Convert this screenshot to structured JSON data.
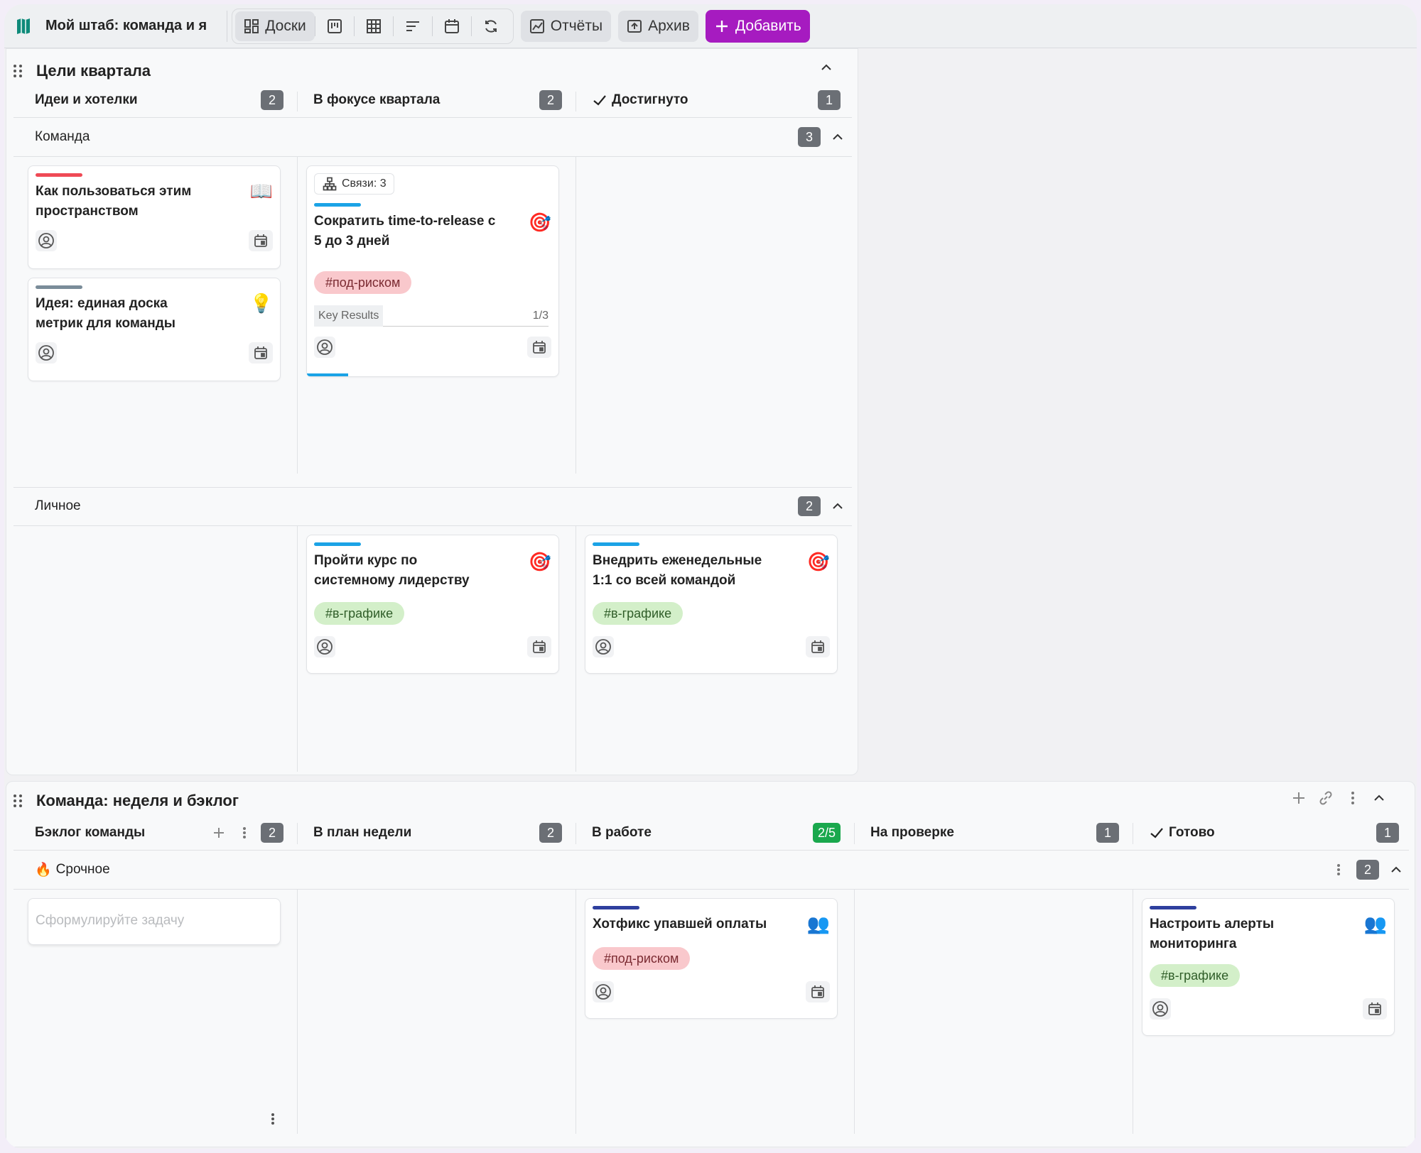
{
  "toolbar": {
    "workspace_title": "Мой штаб: команда и я",
    "boards_label": "Доски",
    "reports_label": "Отчёты",
    "archive_label": "Архив",
    "add_label": "Добавить",
    "accent_color": "#a61bc0"
  },
  "board1": {
    "title": "Цели квартала",
    "columns": [
      {
        "name": "Идеи и хотелки",
        "count": "2"
      },
      {
        "name": "В фокусе квартала",
        "count": "2"
      },
      {
        "name": "Достигнуто",
        "count": "1"
      }
    ],
    "swimlanes": [
      {
        "name": "Команда",
        "count": "3"
      },
      {
        "name": "Личное",
        "count": "2"
      }
    ],
    "cards": {
      "how_to_use": {
        "title_line1": "Как пользоваться этим",
        "title_line2": "пространством",
        "emoji": "📖",
        "stripe_color": "#ef4a55"
      },
      "idea_metrics": {
        "title_line1": "Идея: единая доска",
        "title_line2": "метрик для команды",
        "emoji": "💡",
        "stripe_color": "#7a8c99"
      },
      "time_to_release": {
        "links": "Связи: 3",
        "title_line1": "Сократить time-to-release с",
        "title_line2": "5 до 3 дней",
        "emoji": "🎯",
        "tag": "#под-риском",
        "kr_label": "Key Results",
        "kr_count": "1/3",
        "stripe_color": "#1ba3e6"
      },
      "leadership_course": {
        "title_line1": "Пройти курс по",
        "title_line2": "системному лидерству",
        "emoji": "🎯",
        "tag": "#в-графике",
        "stripe_color": "#1ba3e6"
      },
      "weekly_1on1": {
        "title_line1": "Внедрить еженедельные",
        "title_line2": "1:1 со всей командой",
        "emoji": "🎯",
        "tag": "#в-графике",
        "stripe_color": "#1ba3e6"
      }
    }
  },
  "board2": {
    "title": "Команда: неделя и бэклог",
    "columns": [
      {
        "name": "Бэклог команды",
        "count": "2"
      },
      {
        "name": "В план недели",
        "count": "2"
      },
      {
        "name": "В работе",
        "count": "2/5"
      },
      {
        "name": "На проверке",
        "count": "1"
      },
      {
        "name": "Готово",
        "count": "1"
      }
    ],
    "swimlane": {
      "name": "Срочное",
      "emoji": "🔥",
      "count": "2"
    },
    "new_task_placeholder": "Сформулируйте задачу",
    "cards": {
      "hotfix": {
        "title_line1": "Хотфикс упавшей оплаты",
        "emoji": "👥",
        "tag": "#под-риском",
        "stripe_color": "#2e3f9e"
      },
      "alerts": {
        "title_line1": "Настроить алерты",
        "title_line2": "мониторинга",
        "emoji": "👥",
        "tag": "#в-графике",
        "stripe_color": "#2e3f9e"
      }
    }
  }
}
